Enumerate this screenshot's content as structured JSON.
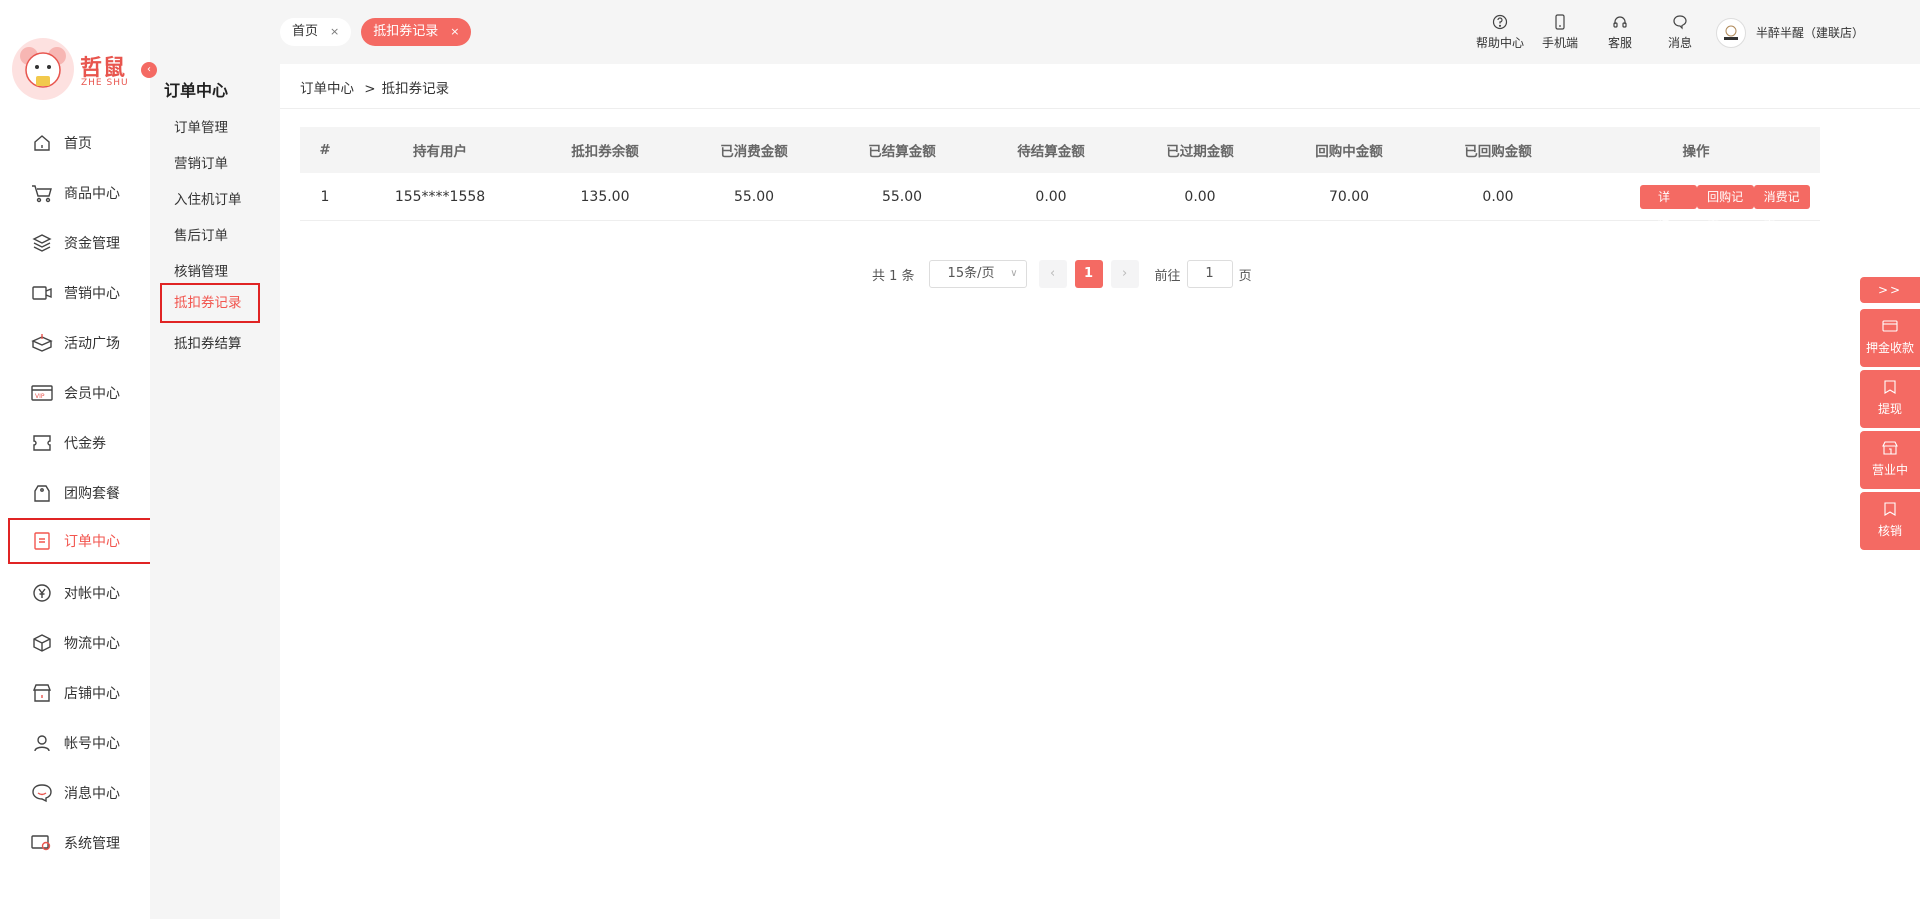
{
  "app": {
    "logo_text": "哲鼠",
    "logo_sub": "ZHE SHU",
    "user_name": "半醉半醒（建联店）"
  },
  "sidebar": {
    "items": [
      {
        "label": "首页",
        "icon": "home-icon"
      },
      {
        "label": "商品中心",
        "icon": "cart-icon"
      },
      {
        "label": "资金管理",
        "icon": "layers-icon"
      },
      {
        "label": "营销中心",
        "icon": "marketing-icon"
      },
      {
        "label": "活动广场",
        "icon": "box-icon"
      },
      {
        "label": "会员中心",
        "icon": "vip-card-icon"
      },
      {
        "label": "代金券",
        "icon": "ticket-icon"
      },
      {
        "label": "团购套餐",
        "icon": "tag-icon"
      },
      {
        "label": "订单中心",
        "icon": "order-icon",
        "active": true
      },
      {
        "label": "对帐中心",
        "icon": "yen-circle-icon"
      },
      {
        "label": "物流中心",
        "icon": "package-icon"
      },
      {
        "label": "店铺中心",
        "icon": "store-icon"
      },
      {
        "label": "帐号中心",
        "icon": "user-icon"
      },
      {
        "label": "消息中心",
        "icon": "chat-icon"
      },
      {
        "label": "系统管理",
        "icon": "settings-icon"
      }
    ]
  },
  "subnav": {
    "title": "订单中心",
    "items": [
      "订单管理",
      "营销订单",
      "入住机订单",
      "售后订单",
      "核销管理",
      "抵扣券记录",
      "抵扣券结算"
    ],
    "active": "抵扣券记录"
  },
  "tabs": [
    {
      "label": "首页",
      "close": "×"
    },
    {
      "label": "抵扣券记录",
      "close": "×",
      "active": true
    }
  ],
  "toolbar": {
    "help": "帮助中心",
    "mobile": "手机端",
    "service": "客服",
    "messages": "消息"
  },
  "breadcrumb": {
    "root": "订单中心",
    "sep": ">",
    "current": "抵扣券记录"
  },
  "table": {
    "headers": [
      "#",
      "持有用户",
      "抵扣券余额",
      "已消费金额",
      "已结算金额",
      "待结算金额",
      "已过期金额",
      "回购中金额",
      "已回购金额",
      "操作"
    ],
    "rows": [
      {
        "cells": [
          "1",
          "155****1558",
          "135.00",
          "55.00",
          "55.00",
          "0.00",
          "0.00",
          "70.00",
          "0.00"
        ],
        "actions": [
          "详 情",
          "回购记录",
          "消费记录"
        ]
      }
    ]
  },
  "pagination": {
    "total": "共 1 条",
    "page_size": "15条/页",
    "prev": "‹",
    "current": "1",
    "next": "›",
    "goto_label": "前往",
    "goto_value": "1",
    "goto_suffix": "页"
  },
  "float_panel": {
    "toggle": ">>",
    "items": [
      "押金收款",
      "提现",
      "营业中",
      "核销"
    ]
  },
  "colors": {
    "accent": "#f46a63",
    "highlight_border": "#e02424"
  }
}
